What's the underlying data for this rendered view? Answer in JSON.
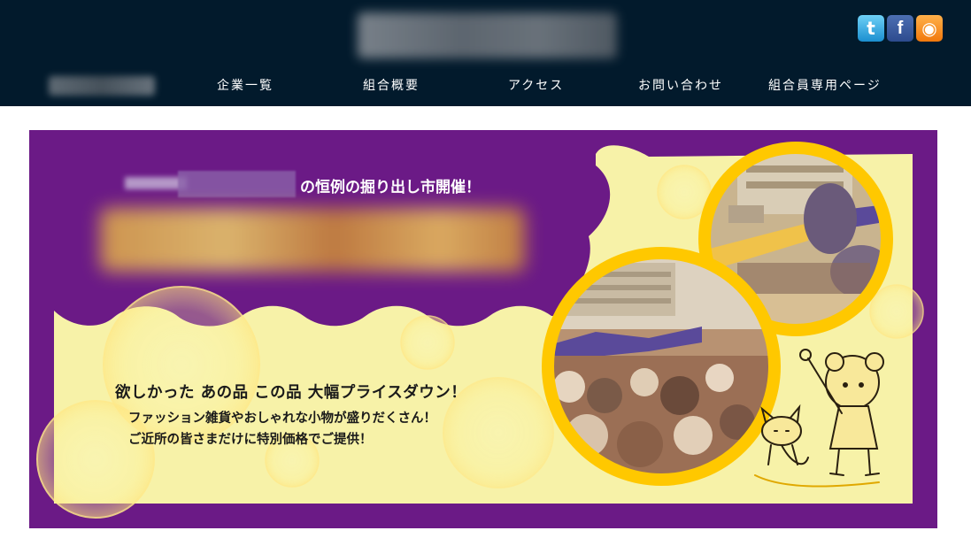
{
  "header": {
    "social": [
      {
        "icon": "twitter-icon",
        "glyph": "t",
        "color": "#1b8fd0"
      },
      {
        "icon": "facebook-icon",
        "glyph": "f",
        "color": "#2d4b8e"
      },
      {
        "icon": "rss-icon",
        "glyph": "◉",
        "color": "#f1780c"
      }
    ],
    "nav": [
      {
        "label": "企業一覧"
      },
      {
        "label": "組合概要"
      },
      {
        "label": "アクセス"
      },
      {
        "label": "お問い合わせ"
      },
      {
        "label": "組合員専用ページ"
      }
    ]
  },
  "banner": {
    "kicker": "の恒例の掘り出し市開催！",
    "headline": "欲しかった あの品 この品 大幅プライスダウン！",
    "line1": "ファッション雑貨やおしゃれな小物が盛りだくさん！",
    "line2": "ご近所の皆さまだけに特別価格でご提供！",
    "colors": {
      "background": "#6b1a86",
      "cream": "#f7f2a8",
      "ring": "#ffc800"
    }
  }
}
